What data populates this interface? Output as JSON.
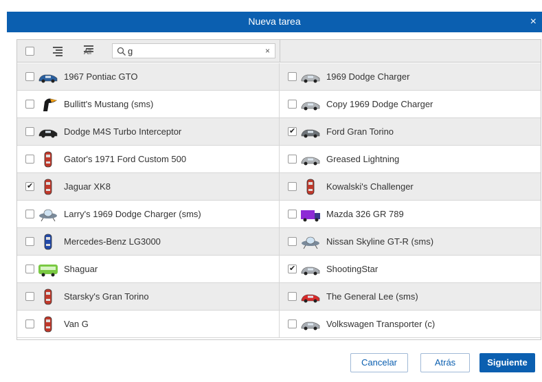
{
  "dialog": {
    "title": "Nueva tarea",
    "close_glyph": "×"
  },
  "toolbar": {
    "select_all_checked": false,
    "indent_icon": "indent-icon",
    "all_icon": "list-all-icon",
    "all_label": "All",
    "search_value": "g",
    "search_clear": "×"
  },
  "vehicles": [
    {
      "name": "1967 Pontiac GTO",
      "checked": false,
      "icon": "sports-car-blue-icon",
      "color": "#2a5f9e"
    },
    {
      "name": "1969 Dodge Charger",
      "checked": false,
      "icon": "sedan-silver-icon",
      "color": "#b0b4b8"
    },
    {
      "name": "Bullitt's Mustang (sms)",
      "checked": false,
      "icon": "toucan-icon",
      "color": "#1a1a1a"
    },
    {
      "name": "Copy 1969 Dodge Charger",
      "checked": false,
      "icon": "sedan-silver-icon",
      "color": "#b0b4b8"
    },
    {
      "name": "Dodge M4S Turbo Interceptor",
      "checked": false,
      "icon": "car-black-icon",
      "color": "#222222"
    },
    {
      "name": "Ford Gran Torino",
      "checked": true,
      "icon": "car-gray-icon",
      "color": "#6e7479"
    },
    {
      "name": "Gator's 1971 Ford Custom 500",
      "checked": false,
      "icon": "car-topview-red-icon",
      "color": "#c0392b"
    },
    {
      "name": "Greased Lightning",
      "checked": false,
      "icon": "sedan-silver-icon",
      "color": "#b0b4b8"
    },
    {
      "name": "Jaguar XK8",
      "checked": true,
      "icon": "car-topview-red-icon",
      "color": "#c0392b"
    },
    {
      "name": "Kowalski's Challenger",
      "checked": false,
      "icon": "car-topview-red-icon",
      "color": "#c0392b"
    },
    {
      "name": "Larry's 1969 Dodge Charger (sms)",
      "checked": false,
      "icon": "ufo-icon",
      "color": "#7a8a9a"
    },
    {
      "name": "Mazda 326 GR 789",
      "checked": false,
      "icon": "truck-purple-icon",
      "color": "#8e2bd6"
    },
    {
      "name": "Mercedes-Benz LG3000",
      "checked": false,
      "icon": "car-topview-blue-icon",
      "color": "#2249a8"
    },
    {
      "name": "Nissan Skyline GT-R (sms)",
      "checked": false,
      "icon": "ufo-icon",
      "color": "#7a8a9a"
    },
    {
      "name": "Shaguar",
      "checked": false,
      "icon": "bus-green-icon",
      "color": "#7ac943"
    },
    {
      "name": "ShootingStar",
      "checked": true,
      "icon": "car-silver-icon",
      "color": "#a8adb3"
    },
    {
      "name": "Starsky's Gran Torino",
      "checked": false,
      "icon": "car-topview-red-icon",
      "color": "#c0392b"
    },
    {
      "name": "The General Lee (sms)",
      "checked": false,
      "icon": "sports-car-red-icon",
      "color": "#d62b2b"
    },
    {
      "name": "Van G",
      "checked": false,
      "icon": "car-topview-red-icon",
      "color": "#c0392b"
    },
    {
      "name": "Volkswagen Transporter (c)",
      "checked": false,
      "icon": "car-silver-icon",
      "color": "#a8adb3"
    }
  ],
  "footer": {
    "cancel_label": "Cancelar",
    "back_label": "Atrás",
    "next_label": "Siguiente"
  },
  "colors": {
    "header_blue": "#0b5fb0",
    "row_shade": "#ececec"
  }
}
